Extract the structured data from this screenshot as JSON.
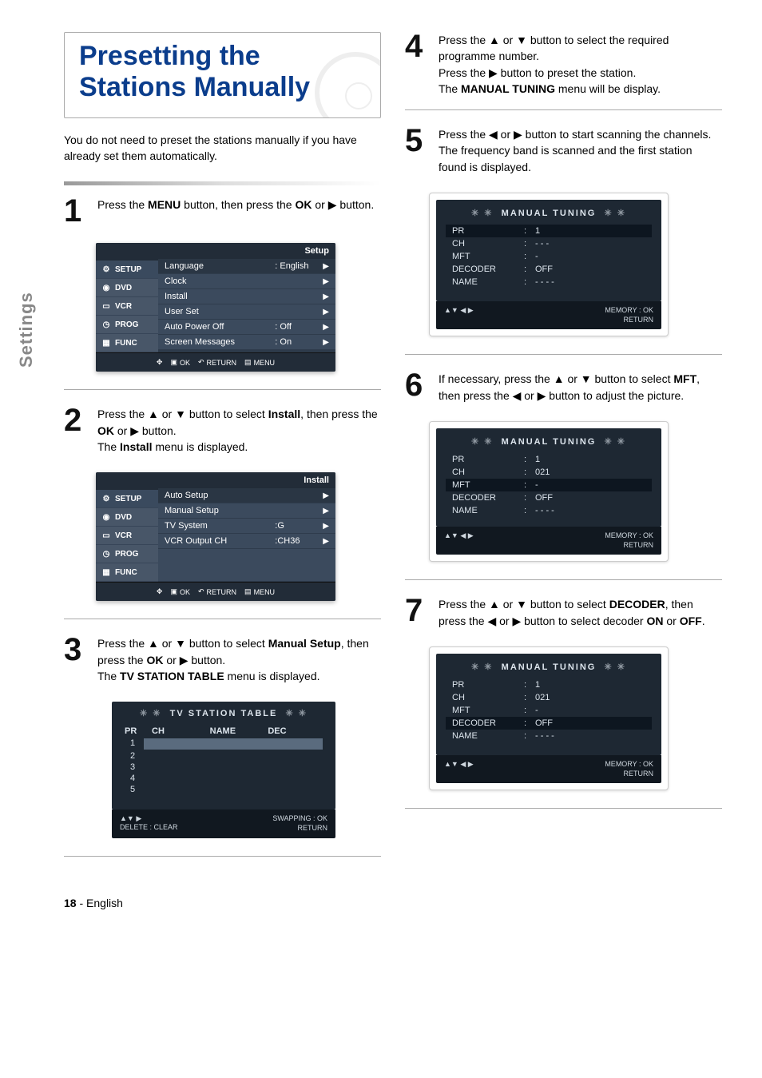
{
  "side_tab": "Settings",
  "title": "Presetting the Stations Manually",
  "intro": "You do not need to preset the stations manually if you have already set them automatically.",
  "steps": {
    "s1": {
      "num": "1",
      "text_prefix": "Press the ",
      "menu": "MENU",
      "mid": " button, then press the ",
      "ok": "OK",
      "or": " or ",
      "btn_sym": "▶",
      "suffix": " button."
    },
    "s2": {
      "num": "2",
      "l1a": "Press the ▲ or ▼ button to select ",
      "l1b": "Install",
      "l1c": ", then press the ",
      "l1d": "OK",
      "l1e": " or ▶ button.",
      "l2a": "The ",
      "l2b": "Install",
      "l2c": " menu is displayed."
    },
    "s3": {
      "num": "3",
      "l1a": "Press the ▲ or ▼ button to select ",
      "l1b": "Manual Setup",
      "l1c": ", then press the ",
      "l1d": "OK",
      "l1e": " or ▶ button.",
      "l2a": "The ",
      "l2b": "TV STATION TABLE",
      "l2c": " menu is displayed."
    },
    "s4": {
      "num": "4",
      "l1": "Press the ▲ or ▼ button to select the required programme number.",
      "l2": "Press the ▶ button to preset the station.",
      "l3a": "The ",
      "l3b": "MANUAL TUNING",
      "l3c": " menu will be display."
    },
    "s5": {
      "num": "5",
      "l1": "Press the ◀ or ▶ button to start scanning the channels.",
      "l2": "The frequency band is scanned and the first station found is displayed."
    },
    "s6": {
      "num": "6",
      "l1a": "If necessary, press the ▲ or ▼ button to select ",
      "l1b": "MFT",
      "l1c": ", then press the ◀ or ▶ button to adjust the picture."
    },
    "s7": {
      "num": "7",
      "l1a": "Press the ▲ or ▼ button to select ",
      "l1b": "DECODER",
      "l1c": ", then press the ◀ or ▶ button to select decoder ",
      "l1d": "ON",
      "l1e": " or ",
      "l1f": "OFF",
      "l1g": "."
    }
  },
  "osd1": {
    "title": "Setup",
    "tabs": [
      "SETUP",
      "DVD",
      "VCR",
      "PROG",
      "FUNC"
    ],
    "items": [
      {
        "label": "Language",
        "value": ": English"
      },
      {
        "label": "Clock",
        "value": ""
      },
      {
        "label": "Install",
        "value": ""
      },
      {
        "label": "User Set",
        "value": ""
      },
      {
        "label": "Auto Power Off",
        "value": ": Off"
      },
      {
        "label": "Screen Messages",
        "value": ": On"
      }
    ],
    "footer": {
      "ok": "OK",
      "ret": "RETURN",
      "menu": "MENU"
    }
  },
  "osd2": {
    "title": "Install",
    "tabs": [
      "SETUP",
      "DVD",
      "VCR",
      "PROG",
      "FUNC"
    ],
    "items": [
      {
        "label": "Auto Setup",
        "value": ""
      },
      {
        "label": "Manual Setup",
        "value": ""
      },
      {
        "label": "TV System",
        "value": ":G"
      },
      {
        "label": "VCR Output CH",
        "value": ":CH36"
      }
    ],
    "footer": {
      "ok": "OK",
      "ret": "RETURN",
      "menu": "MENU"
    }
  },
  "station_table": {
    "title": "TV  STATION  TABLE",
    "cols": [
      "PR",
      "CH",
      "NAME",
      "DEC"
    ],
    "rows": [
      "1",
      "2",
      "3",
      "4",
      "5"
    ],
    "footer_l1": "▲▼  ▶",
    "footer_l2": "DELETE : CLEAR",
    "footer_r1": "SWAPPING : OK",
    "footer_r2": "RETURN"
  },
  "tuning1": {
    "title": "MANUAL TUNING",
    "rows": [
      {
        "k": "PR",
        "v": "1"
      },
      {
        "k": "CH",
        "v": "- - -"
      },
      {
        "k": "MFT",
        "v": "-"
      },
      {
        "k": "DECODER",
        "v": "OFF"
      },
      {
        "k": "NAME",
        "v": "- - - -"
      }
    ],
    "footer_l": "▲▼   ◀ ▶",
    "footer_r1": "MEMORY : OK",
    "footer_r2": "RETURN"
  },
  "tuning2": {
    "title": "MANUAL TUNING",
    "rows": [
      {
        "k": "PR",
        "v": "1"
      },
      {
        "k": "CH",
        "v": "021"
      },
      {
        "k": "MFT",
        "v": "-"
      },
      {
        "k": "DECODER",
        "v": "OFF"
      },
      {
        "k": "NAME",
        "v": "- - - -"
      }
    ],
    "footer_l": "▲▼   ◀ ▶",
    "footer_r1": "MEMORY : OK",
    "footer_r2": "RETURN"
  },
  "tuning3": {
    "title": "MANUAL TUNING",
    "rows": [
      {
        "k": "PR",
        "v": "1"
      },
      {
        "k": "CH",
        "v": "021"
      },
      {
        "k": "MFT",
        "v": "-"
      },
      {
        "k": "DECODER",
        "v": "OFF"
      },
      {
        "k": "NAME",
        "v": "- - - -"
      }
    ],
    "footer_l": "▲▼   ◀ ▶",
    "footer_r1": "MEMORY : OK",
    "footer_r2": "RETURN"
  },
  "page_footer": {
    "num": "18",
    "dash": " - ",
    "lang": "English"
  }
}
